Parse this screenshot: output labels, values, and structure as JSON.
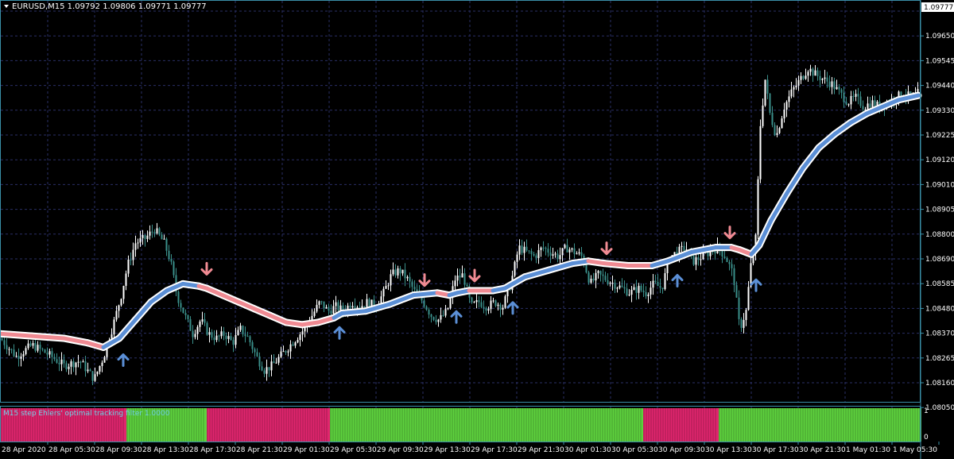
{
  "header": {
    "symbol_line": "EURUSD,M15  1.09792 1.09806 1.09771 1.09777"
  },
  "indicator_window": {
    "label": "M15 step Ehlers' optimal tracking filter 1.0000",
    "scale_top": "1",
    "scale_bottom": "0"
  },
  "colors": {
    "background": "#000000",
    "grid": "#2a2f66",
    "axis_frame": "#3a8fa8",
    "candle_up": "#ffffff",
    "candle_down": "#3a8f8a",
    "filter_up": "#5b8fd6",
    "filter_down": "#f08a92",
    "arrow_up": "#5b8fd6",
    "arrow_down": "#f08a92",
    "hist_up": "#5ed23e",
    "hist_down": "#e0266e",
    "current_price_bg": "#ffffff"
  },
  "chart_data": {
    "type": "line",
    "title": "EURUSD,M15",
    "current_price": "1.09777",
    "ylim": [
      1.0808,
      1.0984
    ],
    "y_ticks": [
      "1.09650",
      "1.09545",
      "1.09440",
      "1.09330",
      "1.09225",
      "1.09120",
      "1.09010",
      "1.08905",
      "1.08800",
      "1.08690",
      "1.08585",
      "1.08480",
      "1.08370",
      "1.08265",
      "1.08160",
      "1.08050"
    ],
    "x_tick_labels": [
      "28 Apr 2020",
      "28 Apr 05:30",
      "28 Apr 09:30",
      "28 Apr 13:30",
      "28 Apr 17:30",
      "28 Apr 21:30",
      "29 Apr 01:30",
      "29 Apr 05:30",
      "29 Apr 09:30",
      "29 Apr 13:30",
      "29 Apr 17:30",
      "29 Apr 21:30",
      "30 Apr 01:30",
      "30 Apr 05:30",
      "30 Apr 09:30",
      "30 Apr 13:30",
      "30 Apr 17:30",
      "30 Apr 21:30",
      "1 May 01:30",
      "1 May 05:30"
    ],
    "price_series": [
      [
        0,
        1.0836
      ],
      [
        20,
        1.0828
      ],
      [
        40,
        1.0833
      ],
      [
        60,
        1.0829
      ],
      [
        80,
        1.0824
      ],
      [
        100,
        1.0826
      ],
      [
        118,
        1.0818
      ],
      [
        130,
        1.0828
      ],
      [
        142,
        1.0842
      ],
      [
        152,
        1.0855
      ],
      [
        160,
        1.0868
      ],
      [
        170,
        1.0878
      ],
      [
        182,
        1.088
      ],
      [
        194,
        1.0884
      ],
      [
        206,
        1.0878
      ],
      [
        214,
        1.087
      ],
      [
        222,
        1.0855
      ],
      [
        232,
        1.0846
      ],
      [
        242,
        1.0838
      ],
      [
        252,
        1.0844
      ],
      [
        262,
        1.0838
      ],
      [
        272,
        1.0836
      ],
      [
        282,
        1.0838
      ],
      [
        292,
        1.0834
      ],
      [
        302,
        1.084
      ],
      [
        312,
        1.0836
      ],
      [
        322,
        1.0828
      ],
      [
        332,
        1.0822
      ],
      [
        342,
        1.0824
      ],
      [
        352,
        1.0828
      ],
      [
        362,
        1.0832
      ],
      [
        372,
        1.0836
      ],
      [
        382,
        1.084
      ],
      [
        392,
        1.0846
      ],
      [
        402,
        1.0852
      ],
      [
        412,
        1.0848
      ],
      [
        422,
        1.085
      ],
      [
        432,
        1.0848
      ],
      [
        442,
        1.0852
      ],
      [
        452,
        1.085
      ],
      [
        462,
        1.0852
      ],
      [
        472,
        1.085
      ],
      [
        482,
        1.0856
      ],
      [
        492,
        1.0864
      ],
      [
        502,
        1.0866
      ],
      [
        512,
        1.0862
      ],
      [
        522,
        1.0856
      ],
      [
        532,
        1.0852
      ],
      [
        542,
        1.0846
      ],
      [
        552,
        1.0844
      ],
      [
        562,
        1.0848
      ],
      [
        572,
        1.0862
      ],
      [
        582,
        1.0864
      ],
      [
        592,
        1.085
      ],
      [
        602,
        1.0852
      ],
      [
        612,
        1.085
      ],
      [
        622,
        1.0852
      ],
      [
        632,
        1.085
      ],
      [
        642,
        1.086
      ],
      [
        652,
        1.0876
      ],
      [
        662,
        1.0874
      ],
      [
        672,
        1.0872
      ],
      [
        682,
        1.0876
      ],
      [
        692,
        1.0874
      ],
      [
        702,
        1.0872
      ],
      [
        712,
        1.0876
      ],
      [
        722,
        1.0874
      ],
      [
        732,
        1.0872
      ],
      [
        742,
        1.086
      ],
      [
        752,
        1.0864
      ],
      [
        762,
        1.0862
      ],
      [
        772,
        1.086
      ],
      [
        782,
        1.0858
      ],
      [
        792,
        1.0856
      ],
      [
        802,
        1.0858
      ],
      [
        812,
        1.0856
      ],
      [
        822,
        1.086
      ],
      [
        832,
        1.0858
      ],
      [
        842,
        1.0872
      ],
      [
        852,
        1.0874
      ],
      [
        862,
        1.0876
      ],
      [
        872,
        1.087
      ],
      [
        882,
        1.0872
      ],
      [
        892,
        1.0874
      ],
      [
        902,
        1.0876
      ],
      [
        912,
        1.0872
      ],
      [
        922,
        1.0864
      ],
      [
        930,
        1.084
      ],
      [
        938,
        1.0848
      ],
      [
        944,
        1.0868
      ],
      [
        950,
        1.088
      ],
      [
        956,
        1.093
      ],
      [
        962,
        1.095
      ],
      [
        968,
        1.0935
      ],
      [
        976,
        1.0925
      ],
      [
        986,
        1.0938
      ],
      [
        996,
        1.0945
      ],
      [
        1006,
        1.095
      ],
      [
        1016,
        1.0955
      ],
      [
        1026,
        1.0952
      ],
      [
        1036,
        1.095
      ],
      [
        1046,
        1.0948
      ],
      [
        1056,
        1.0944
      ],
      [
        1066,
        1.094
      ],
      [
        1076,
        1.0942
      ],
      [
        1086,
        1.0938
      ],
      [
        1096,
        1.094
      ],
      [
        1106,
        1.0938
      ],
      [
        1116,
        1.094
      ],
      [
        1126,
        1.0942
      ],
      [
        1136,
        1.0944
      ],
      [
        1146,
        1.0942
      ],
      [
        1154,
        1.0944
      ]
    ],
    "filter_series": [
      [
        0,
        1.0838,
        "down"
      ],
      [
        40,
        1.0837,
        "down"
      ],
      [
        80,
        1.0836,
        "down"
      ],
      [
        110,
        1.0834,
        "down"
      ],
      [
        130,
        1.0832,
        "down"
      ],
      [
        150,
        1.0836,
        "up"
      ],
      [
        170,
        1.0844,
        "up"
      ],
      [
        190,
        1.0852,
        "up"
      ],
      [
        210,
        1.0857,
        "up"
      ],
      [
        230,
        1.086,
        "up"
      ],
      [
        250,
        1.0859,
        "up"
      ],
      [
        260,
        1.0858,
        "down"
      ],
      [
        280,
        1.0855,
        "down"
      ],
      [
        300,
        1.0852,
        "down"
      ],
      [
        320,
        1.0849,
        "down"
      ],
      [
        340,
        1.0846,
        "down"
      ],
      [
        360,
        1.0843,
        "down"
      ],
      [
        380,
        1.0842,
        "down"
      ],
      [
        400,
        1.0843,
        "down"
      ],
      [
        420,
        1.0845,
        "down"
      ],
      [
        430,
        1.0847,
        "up"
      ],
      [
        460,
        1.0848,
        "up"
      ],
      [
        490,
        1.0851,
        "up"
      ],
      [
        520,
        1.0855,
        "up"
      ],
      [
        550,
        1.0856,
        "up"
      ],
      [
        565,
        1.0855,
        "down"
      ],
      [
        575,
        1.0856,
        "up"
      ],
      [
        590,
        1.0857,
        "up"
      ],
      [
        600,
        1.0857,
        "down"
      ],
      [
        620,
        1.0857,
        "down"
      ],
      [
        635,
        1.0858,
        "up"
      ],
      [
        660,
        1.0863,
        "up"
      ],
      [
        690,
        1.0866,
        "up"
      ],
      [
        720,
        1.0869,
        "up"
      ],
      [
        740,
        1.087,
        "up"
      ],
      [
        760,
        1.0869,
        "down"
      ],
      [
        790,
        1.0868,
        "down"
      ],
      [
        820,
        1.0868,
        "down"
      ],
      [
        840,
        1.087,
        "up"
      ],
      [
        870,
        1.0874,
        "up"
      ],
      [
        900,
        1.0876,
        "up"
      ],
      [
        920,
        1.0876,
        "up"
      ],
      [
        930,
        1.0875,
        "down"
      ],
      [
        945,
        1.0873,
        "down"
      ],
      [
        955,
        1.0877,
        "up"
      ],
      [
        970,
        1.0888,
        "up"
      ],
      [
        990,
        1.09,
        "up"
      ],
      [
        1010,
        1.0911,
        "up"
      ],
      [
        1030,
        1.092,
        "up"
      ],
      [
        1050,
        1.0926,
        "up"
      ],
      [
        1070,
        1.0931,
        "up"
      ],
      [
        1090,
        1.0935,
        "up"
      ],
      [
        1110,
        1.0938,
        "up"
      ],
      [
        1130,
        1.0941,
        "up"
      ],
      [
        1155,
        1.0943,
        "up"
      ]
    ],
    "signals": [
      {
        "type": "up",
        "x": 155,
        "price": 1.0826
      },
      {
        "type": "down",
        "x": 260,
        "price": 1.0867
      },
      {
        "type": "up",
        "x": 427,
        "price": 1.0838
      },
      {
        "type": "down",
        "x": 534,
        "price": 1.0862
      },
      {
        "type": "down",
        "x": 597,
        "price": 1.0864
      },
      {
        "type": "up",
        "x": 574,
        "price": 1.0845
      },
      {
        "type": "up",
        "x": 645,
        "price": 1.0849
      },
      {
        "type": "down",
        "x": 763,
        "price": 1.0876
      },
      {
        "type": "up",
        "x": 852,
        "price": 1.0861
      },
      {
        "type": "down",
        "x": 918,
        "price": 1.0883
      },
      {
        "type": "up",
        "x": 951,
        "price": 1.0859
      }
    ],
    "histogram_segments": [
      {
        "x0": 0,
        "x1": 158,
        "state": "down"
      },
      {
        "x0": 158,
        "x1": 259,
        "state": "up"
      },
      {
        "x0": 259,
        "x1": 414,
        "state": "down"
      },
      {
        "x0": 414,
        "x1": 808,
        "state": "up"
      },
      {
        "x0": 808,
        "x1": 903,
        "state": "down"
      },
      {
        "x0": 903,
        "x1": 1158,
        "state": "up"
      }
    ]
  }
}
